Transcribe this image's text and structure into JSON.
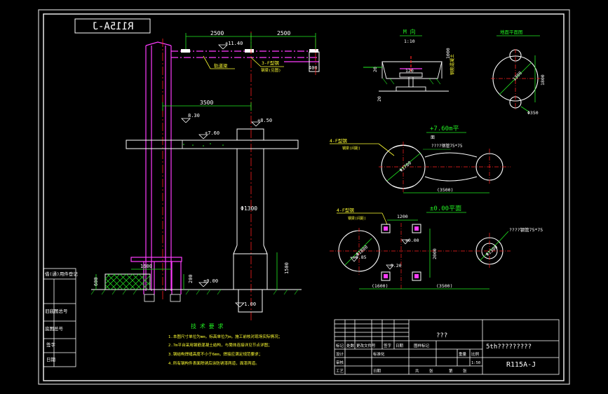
{
  "drawing": {
    "code_mirrored": "R115A-J",
    "code": "R115A-J",
    "title_block_main": "???",
    "title_block_name": "5th?????????",
    "title_block_headers": [
      "标记",
      "处数",
      "更改文件号",
      "签字",
      "日期"
    ],
    "title_block_row2": [
      "设计",
      "",
      "标准化",
      "",
      "图样标记",
      "重量",
      "比例"
    ],
    "title_block_row3": [
      "审核",
      "",
      "",
      "",
      "",
      "",
      "1:50"
    ],
    "title_block_row4": [
      "工艺",
      "",
      "日期",
      "",
      "共",
      "张",
      "第",
      "张"
    ]
  },
  "left_stamp": {
    "labels": [
      "借(通)用件登记",
      "旧底图总号",
      "底图总号",
      "签字",
      "日期"
    ]
  },
  "elevation": {
    "dim_2500_left": "2500",
    "dim_2500_right": "2500",
    "dim_3500": "3500",
    "dim_400": "400",
    "level_1140": "+11.40",
    "level_830": "8.30",
    "level_760": "+7.60",
    "level_850": "+8.50",
    "level_000": "±0.00",
    "level_m100": "-1.00",
    "dim_1600": "1600",
    "dim_600": "600",
    "dim_200": "200",
    "dim_1500": "1500",
    "diameter_1300": "Φ1300",
    "label_rail": "轨道梁",
    "label_beam": "3-F型钢",
    "label_beam_note": "钢梁(见图)"
  },
  "notes": {
    "title": "技 术 要 求",
    "items": [
      "1.本图尺寸单位为mm，标高单位为m，施工前核对现场实际情况；",
      "2.7m平台采用钢筋混凝土结构，与筒体连接详见节点详图；",
      "3.钢结构焊缝高度不小于6mm，焊接应满足规范要求；",
      "4.所有钢构件表面除锈后涂防锈漆两道，面漆两道。"
    ]
  },
  "section_mm": {
    "title": "M  向",
    "scale": "1:10",
    "dim_120": "120",
    "dim_20a": "20",
    "dim_20b": "20",
    "dim_1000": "1000",
    "label": "钢筋混凝土"
  },
  "section_anchor": {
    "title": "地面平面图",
    "dim_1300": "1300",
    "dim_1800": "1800",
    "dim_350": "Φ350"
  },
  "plan_760": {
    "title": "+7.60m平",
    "scale": "面",
    "label_left": "4-F型钢",
    "label_left_note": "钢梁(间距)",
    "dim_1700": "Φ1700",
    "note_right": "????钢管75*75",
    "dim_3500": "(3500)"
  },
  "plan_000": {
    "title": "±0.00平面",
    "label_left": "4-F型钢",
    "label_left_note": "钢梁(间距)",
    "dim_1200": "1200",
    "dim_2000": "2000",
    "dim_1600": "(1600)",
    "dim_3500": "(3500)",
    "level_000": "±0.00",
    "level_085": "±0.85",
    "level_m020": "-0.20",
    "dim_1800": "Φ1800",
    "dim_1300": "Φ1300",
    "note_right": "????钢管75*75"
  }
}
